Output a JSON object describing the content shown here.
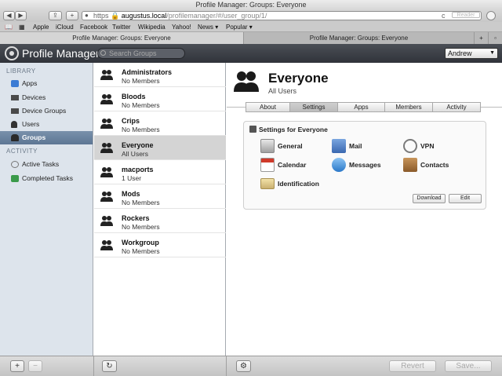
{
  "window": {
    "title": "Profile Manager: Groups: Everyone"
  },
  "browser": {
    "back": "◀",
    "forward": "▶",
    "share": "⇪",
    "add": "+",
    "url": {
      "protocol": "https",
      "host": "augustus.local",
      "path": "/profilemanager/#/user_group/1/"
    },
    "reader": "Reader",
    "reload": "c",
    "bookmarks": [
      "Apple",
      "iCloud",
      "Facebook",
      "Twitter",
      "Wikipedia",
      "Yahoo!",
      "News ▾",
      "Popular ▾"
    ],
    "tabs": [
      {
        "label": "Profile Manager: Groups: Everyone"
      },
      {
        "label": "Profile Manager: Groups: Everyone"
      }
    ],
    "new_tab": "+"
  },
  "header": {
    "app_title": "Profile Manager",
    "search_placeholder": "Search Groups",
    "user": "Andrew"
  },
  "sidebar": {
    "library_heading": "LIBRARY",
    "library": [
      {
        "label": "Apps",
        "icon": "apps-icon",
        "color": "#3b7bd4"
      },
      {
        "label": "Devices",
        "icon": "devices-icon",
        "color": "#4a4a4a"
      },
      {
        "label": "Device Groups",
        "icon": "device-groups-icon",
        "color": "#4a4a4a"
      },
      {
        "label": "Users",
        "icon": "user-icon",
        "color": "#333333"
      },
      {
        "label": "Groups",
        "icon": "group-icon",
        "color": "#333333"
      }
    ],
    "activity_heading": "ACTIVITY",
    "activity": [
      {
        "label": "Active Tasks",
        "icon": "active-tasks-icon",
        "color": "#777777"
      },
      {
        "label": "Completed Tasks",
        "icon": "completed-tasks-icon",
        "color": "#3a9a4a"
      }
    ]
  },
  "groups": [
    {
      "name": "Administrators",
      "members": "No Members"
    },
    {
      "name": "Bloods",
      "members": "No Members"
    },
    {
      "name": "Crips",
      "members": "No Members"
    },
    {
      "name": "Everyone",
      "members": "All Users"
    },
    {
      "name": "macports",
      "members": "1 User"
    },
    {
      "name": "Mods",
      "members": "No Members"
    },
    {
      "name": "Rockers",
      "members": "No Members"
    },
    {
      "name": "Workgroup",
      "members": "No Members"
    }
  ],
  "detail": {
    "title": "Everyone",
    "subtitle": "All Users",
    "tabs": [
      "About",
      "Settings",
      "Apps",
      "Members",
      "Activity"
    ],
    "panel_title": "Settings for Everyone",
    "settings": [
      {
        "label": "General",
        "icon": "general-icon",
        "color": "#9a9a9a"
      },
      {
        "label": "Mail",
        "icon": "mail-icon",
        "color": "#4a79c0"
      },
      {
        "label": "VPN",
        "icon": "vpn-icon",
        "color": "#7a7a7a"
      },
      {
        "label": "Calendar",
        "icon": "calendar-icon",
        "color": "#d03a2a"
      },
      {
        "label": "Messages",
        "icon": "messages-icon",
        "color": "#3a8ad4"
      },
      {
        "label": "Contacts",
        "icon": "contacts-icon",
        "color": "#a0703a"
      },
      {
        "label": "Identification",
        "icon": "identification-icon",
        "color": "#c9b070"
      }
    ],
    "download_label": "Download",
    "edit_label": "Edit"
  },
  "footer": {
    "add": "+",
    "remove": "−",
    "refresh": "↻",
    "gear": "⚙",
    "revert": "Revert",
    "save": "Save..."
  }
}
